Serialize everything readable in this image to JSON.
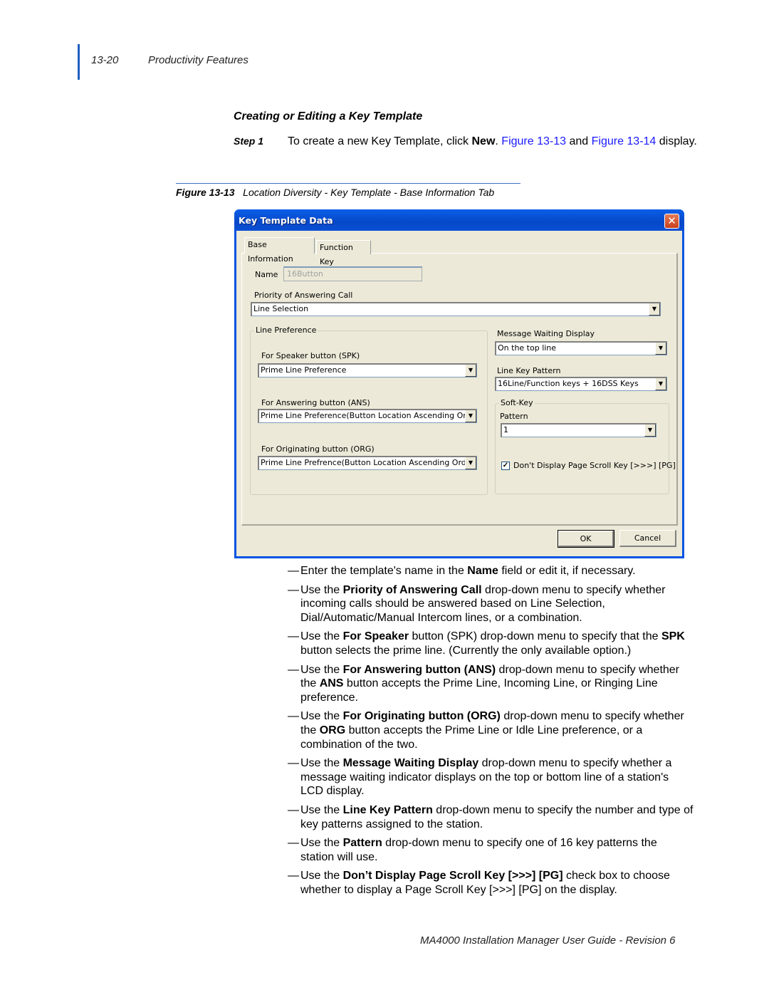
{
  "header": {
    "page_number": "13-20",
    "chapter": "Productivity Features"
  },
  "section": {
    "title": "Creating or Editing a Key Template",
    "step_label": "Step 1",
    "step_text_parts": {
      "t1": "To create a new Key Template, click ",
      "b1": "New",
      "t2": ". ",
      "link1": "Figure 13-13",
      "t3": " and ",
      "link2": "Figure 13-14",
      "t4": " display."
    }
  },
  "figure": {
    "label": "Figure 13-13",
    "caption": "Location Diversity - Key Template - Base Information Tab"
  },
  "dialog": {
    "title": "Key Template Data",
    "close_glyph": "✕",
    "tabs": [
      {
        "label": "Base Information",
        "active": true
      },
      {
        "label": "Function Key",
        "active": false
      }
    ],
    "name_label": "Name",
    "name_value": "16Button",
    "priority_label": "Priority of Answering Call",
    "priority_value": "Line Selection",
    "line_pref_group": "Line Preference",
    "spk_label": "For Speaker button (SPK)",
    "spk_value": "Prime Line Preference",
    "ans_label": "For Answering button (ANS)",
    "ans_value": "Prime Line Preference(Button Location Ascending Order",
    "org_label": "For Originating button (ORG)",
    "org_value": "Prime Line Prefrence(Button Location Ascending Order)",
    "mwd_label": "Message Waiting Display",
    "mwd_value": "On the top line",
    "lkp_label": "Line Key Pattern",
    "lkp_value": "16Line/Function keys + 16DSS Keys",
    "softkey_group": "Soft-Key",
    "pattern_label": "Pattern",
    "pattern_value": "1",
    "scroll_checkbox_label": "Don't Display Page Scroll Key [>>>] [PG]",
    "scroll_checkbox_checked": true,
    "check_glyph": "✓",
    "arrow_glyph": "▼",
    "ok_label": "OK",
    "cancel_label": "Cancel"
  },
  "bullets": [
    {
      "dash": "—",
      "parts": [
        [
          "t",
          "Enter the template's name in the "
        ],
        [
          "b",
          "Name"
        ],
        [
          "t",
          " field or edit it, if necessary."
        ]
      ]
    },
    {
      "dash": "—",
      "parts": [
        [
          "t",
          "Use the "
        ],
        [
          "b",
          "Priority of Answering Call"
        ],
        [
          "t",
          " drop-down menu to specify whether incoming calls should be answered based on Line Selection, Dial/Automatic/Manual Intercom lines, or a combination."
        ]
      ]
    },
    {
      "dash": "—",
      "parts": [
        [
          "t",
          "Use the "
        ],
        [
          "b",
          "For Speaker"
        ],
        [
          "t",
          " button (SPK) drop-down menu to specify that the "
        ],
        [
          "b",
          "SPK"
        ],
        [
          "t",
          " button selects the prime line. (Currently the only available option.)"
        ]
      ]
    },
    {
      "dash": "—",
      "parts": [
        [
          "t",
          "Use the "
        ],
        [
          "b",
          "For Answering button (ANS)"
        ],
        [
          "t",
          " drop-down menu to specify whether the "
        ],
        [
          "b",
          "ANS"
        ],
        [
          "t",
          " button accepts the Prime Line, Incoming Line, or Ringing Line preference."
        ]
      ]
    },
    {
      "dash": "—",
      "parts": [
        [
          "t",
          "Use the "
        ],
        [
          "b",
          "For Originating button (ORG)"
        ],
        [
          "t",
          " drop-down menu to specify whether the "
        ],
        [
          "b",
          "ORG"
        ],
        [
          "t",
          " button accepts the Prime Line or Idle Line preference, or a combination of the two."
        ]
      ]
    },
    {
      "dash": "—",
      "parts": [
        [
          "t",
          "Use the "
        ],
        [
          "b",
          "Message Waiting Display"
        ],
        [
          "t",
          " drop-down menu to specify whether a message waiting indicator displays on the top or bottom line of a station's LCD display."
        ]
      ]
    },
    {
      "dash": "—",
      "parts": [
        [
          "t",
          "Use the "
        ],
        [
          "b",
          "Line Key Pattern"
        ],
        [
          "t",
          " drop-down menu to specify the number and type of key patterns assigned to the station."
        ]
      ]
    },
    {
      "dash": "—",
      "parts": [
        [
          "t",
          "Use the "
        ],
        [
          "b",
          "Pattern"
        ],
        [
          "t",
          " drop-down menu to specify one of 16 key patterns the station will use."
        ]
      ]
    },
    {
      "dash": "—",
      "parts": [
        [
          "t",
          "Use the "
        ],
        [
          "b",
          "Don’t Display Page Scroll Key [>>>] [PG]"
        ],
        [
          "t",
          " check box to choose whether to display a Page Scroll Key [>>>] [PG] on the display."
        ]
      ]
    }
  ],
  "footer": {
    "text": "MA4000 Installation Manager User Guide - Revision 6"
  }
}
